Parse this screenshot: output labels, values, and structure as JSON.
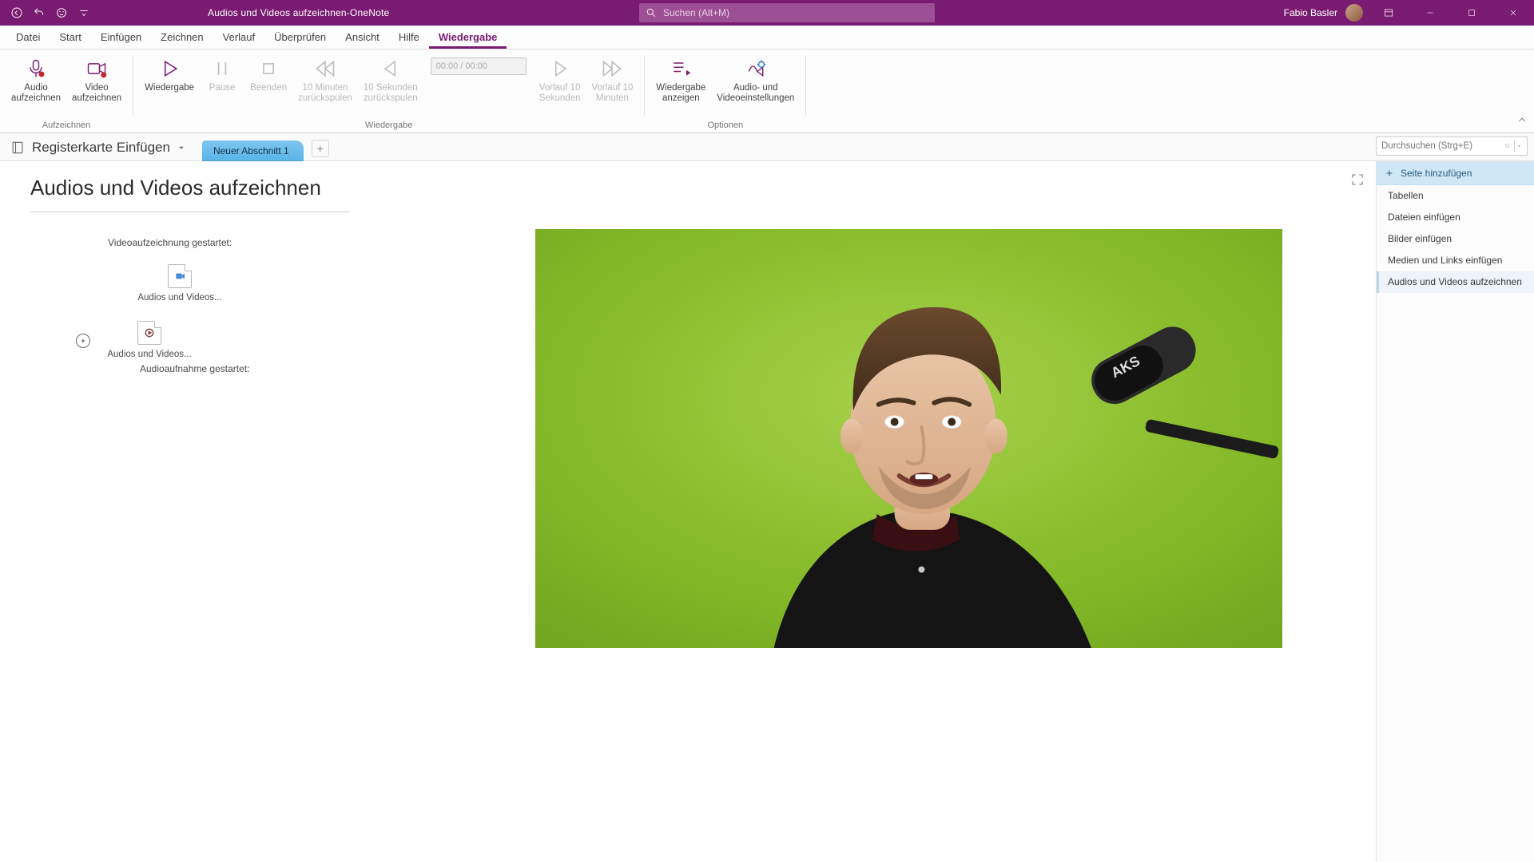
{
  "titlebar": {
    "doc_title": "Audios und Videos aufzeichnen",
    "separator": "  -  ",
    "app_name": "OneNote",
    "search_placeholder": "Suchen (Alt+M)",
    "username": "Fabio Basler"
  },
  "tabs": {
    "file": "Datei",
    "start": "Start",
    "insert": "Einfügen",
    "draw": "Zeichnen",
    "history": "Verlauf",
    "review": "Überprüfen",
    "view": "Ansicht",
    "help": "Hilfe",
    "playback": "Wiedergabe"
  },
  "ribbon": {
    "group_record": "Aufzeichnen",
    "record_audio": "Audio\naufzeichnen",
    "record_video": "Video\naufzeichnen",
    "group_playback": "Wiedergabe",
    "play": "Wiedergabe",
    "pause": "Pause",
    "stop": "Beenden",
    "rewind10m": "10 Minuten\nzurückspulen",
    "rewind10s": "10 Sekunden\nzurückspulen",
    "timebox": "00:00 / 00:00",
    "fwd10s": "Vorlauf 10\nSekunden",
    "fwd10m": "Vorlauf 10\nMinuten",
    "group_options": "Optionen",
    "see_playback": "Wiedergabe\nanzeigen",
    "av_settings": "Audio- und\nVideoeinstellungen"
  },
  "nav": {
    "notebook": "Registerkarte Einfügen",
    "section": "Neuer Abschnitt 1",
    "search_placeholder": "Durchsuchen (Strg+E)"
  },
  "page": {
    "title": "Audios und Videos aufzeichnen",
    "line_video": "Videoaufzeichnung gestartet:",
    "attach1": "Audios und\nVideos...",
    "attach2": "Audios und\nVideos...",
    "line_audio": "Audioaufnahme gestartet:"
  },
  "page_pane": {
    "add_page": "Seite hinzufügen",
    "items": [
      "Tabellen",
      "Dateien einfügen",
      "Bilder einfügen",
      "Medien und Links einfügen",
      "Audios und Videos aufzeichnen"
    ]
  }
}
